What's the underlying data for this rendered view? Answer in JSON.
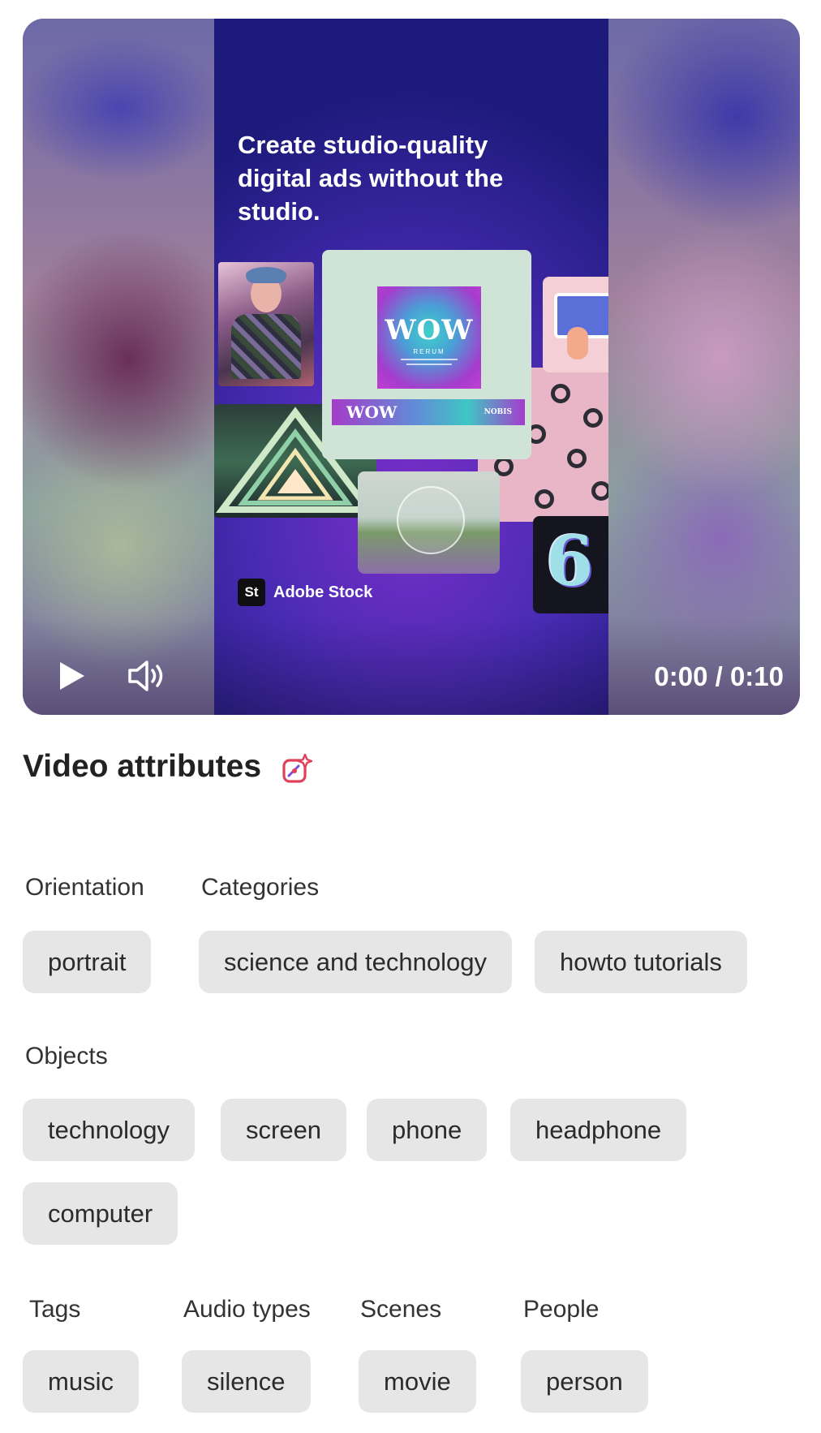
{
  "video": {
    "headline": "Create studio-quality digital ads without the studio.",
    "card_wordmark": "WOW",
    "card_subtitle": "RERUM",
    "banner_wordmark": "WOW",
    "banner_tag": "NOBIS",
    "badge_glyph": "6",
    "brand_logo": "St",
    "brand_name": "Adobe Stock",
    "time": "0:00 / 0:10",
    "play_icon": "play-icon",
    "volume_icon": "volume-icon"
  },
  "attributes": {
    "title": "Video attributes",
    "ai_icon": "ai-sparkle-icon",
    "accent_color": "#e0405a",
    "orientation": {
      "label": "Orientation",
      "chips": [
        "portrait"
      ]
    },
    "categories": {
      "label": "Categories",
      "chips": [
        "science and technology",
        "howto tutorials"
      ]
    },
    "objects": {
      "label": "Objects",
      "chips": [
        "technology",
        "screen",
        "phone",
        "headphone",
        "computer"
      ]
    },
    "tags": {
      "label": "Tags",
      "chips": [
        "music"
      ]
    },
    "audio_types": {
      "label": "Audio types",
      "chips": [
        "silence"
      ]
    },
    "scenes": {
      "label": "Scenes",
      "chips": [
        "movie"
      ]
    },
    "people": {
      "label": "People",
      "chips": [
        "person"
      ]
    }
  }
}
